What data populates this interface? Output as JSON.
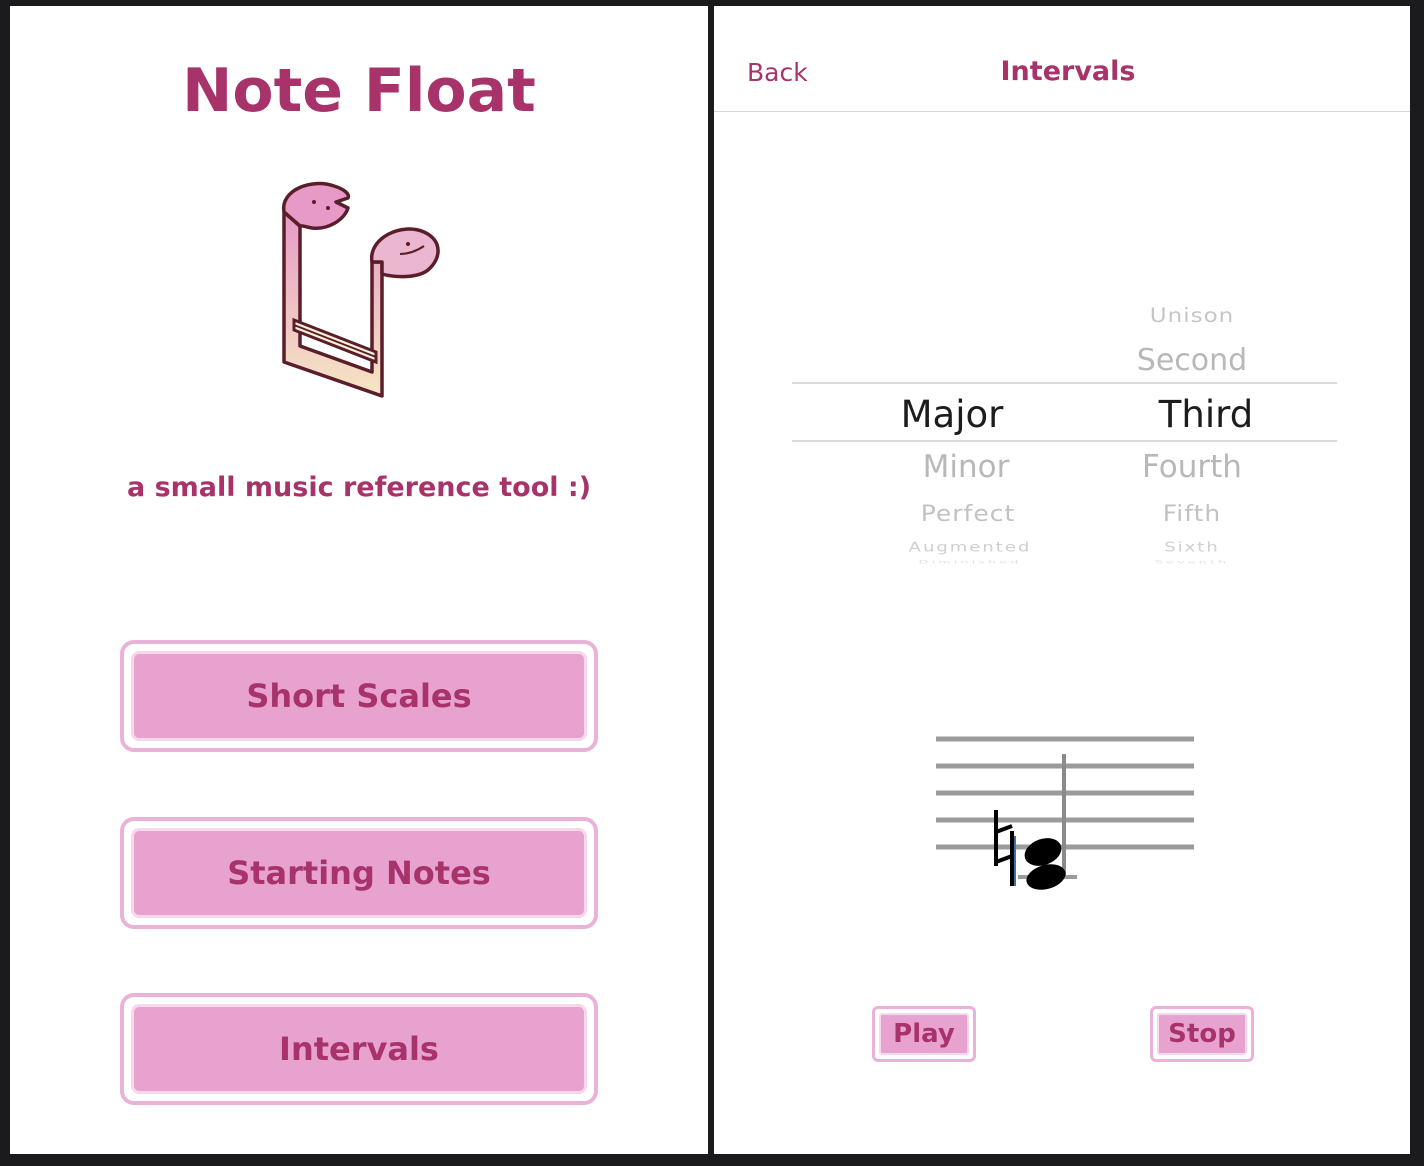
{
  "colors": {
    "accent": "#a8336a",
    "button_fill": "#e8a2cf",
    "button_border": "#eab2d8"
  },
  "home": {
    "title": "Note Float",
    "tagline": "a small music reference tool :)",
    "logo_icon": "double-eighth-note-mascot",
    "buttons": [
      "Short Scales",
      "Starting Notes",
      "Intervals"
    ]
  },
  "intervals": {
    "back_label": "Back",
    "title": "Intervals",
    "picker": {
      "quality_options": [
        "Major",
        "Minor",
        "Perfect",
        "Augmented",
        "Diminished"
      ],
      "number_options": [
        "Unison",
        "Second",
        "Third",
        "Fourth",
        "Fifth",
        "Sixth",
        "Seventh"
      ],
      "selected_quality": "Major",
      "selected_number": "Third"
    },
    "staff_icon": "natural-sign-interval-notes",
    "play_label": "Play",
    "stop_label": "Stop"
  }
}
